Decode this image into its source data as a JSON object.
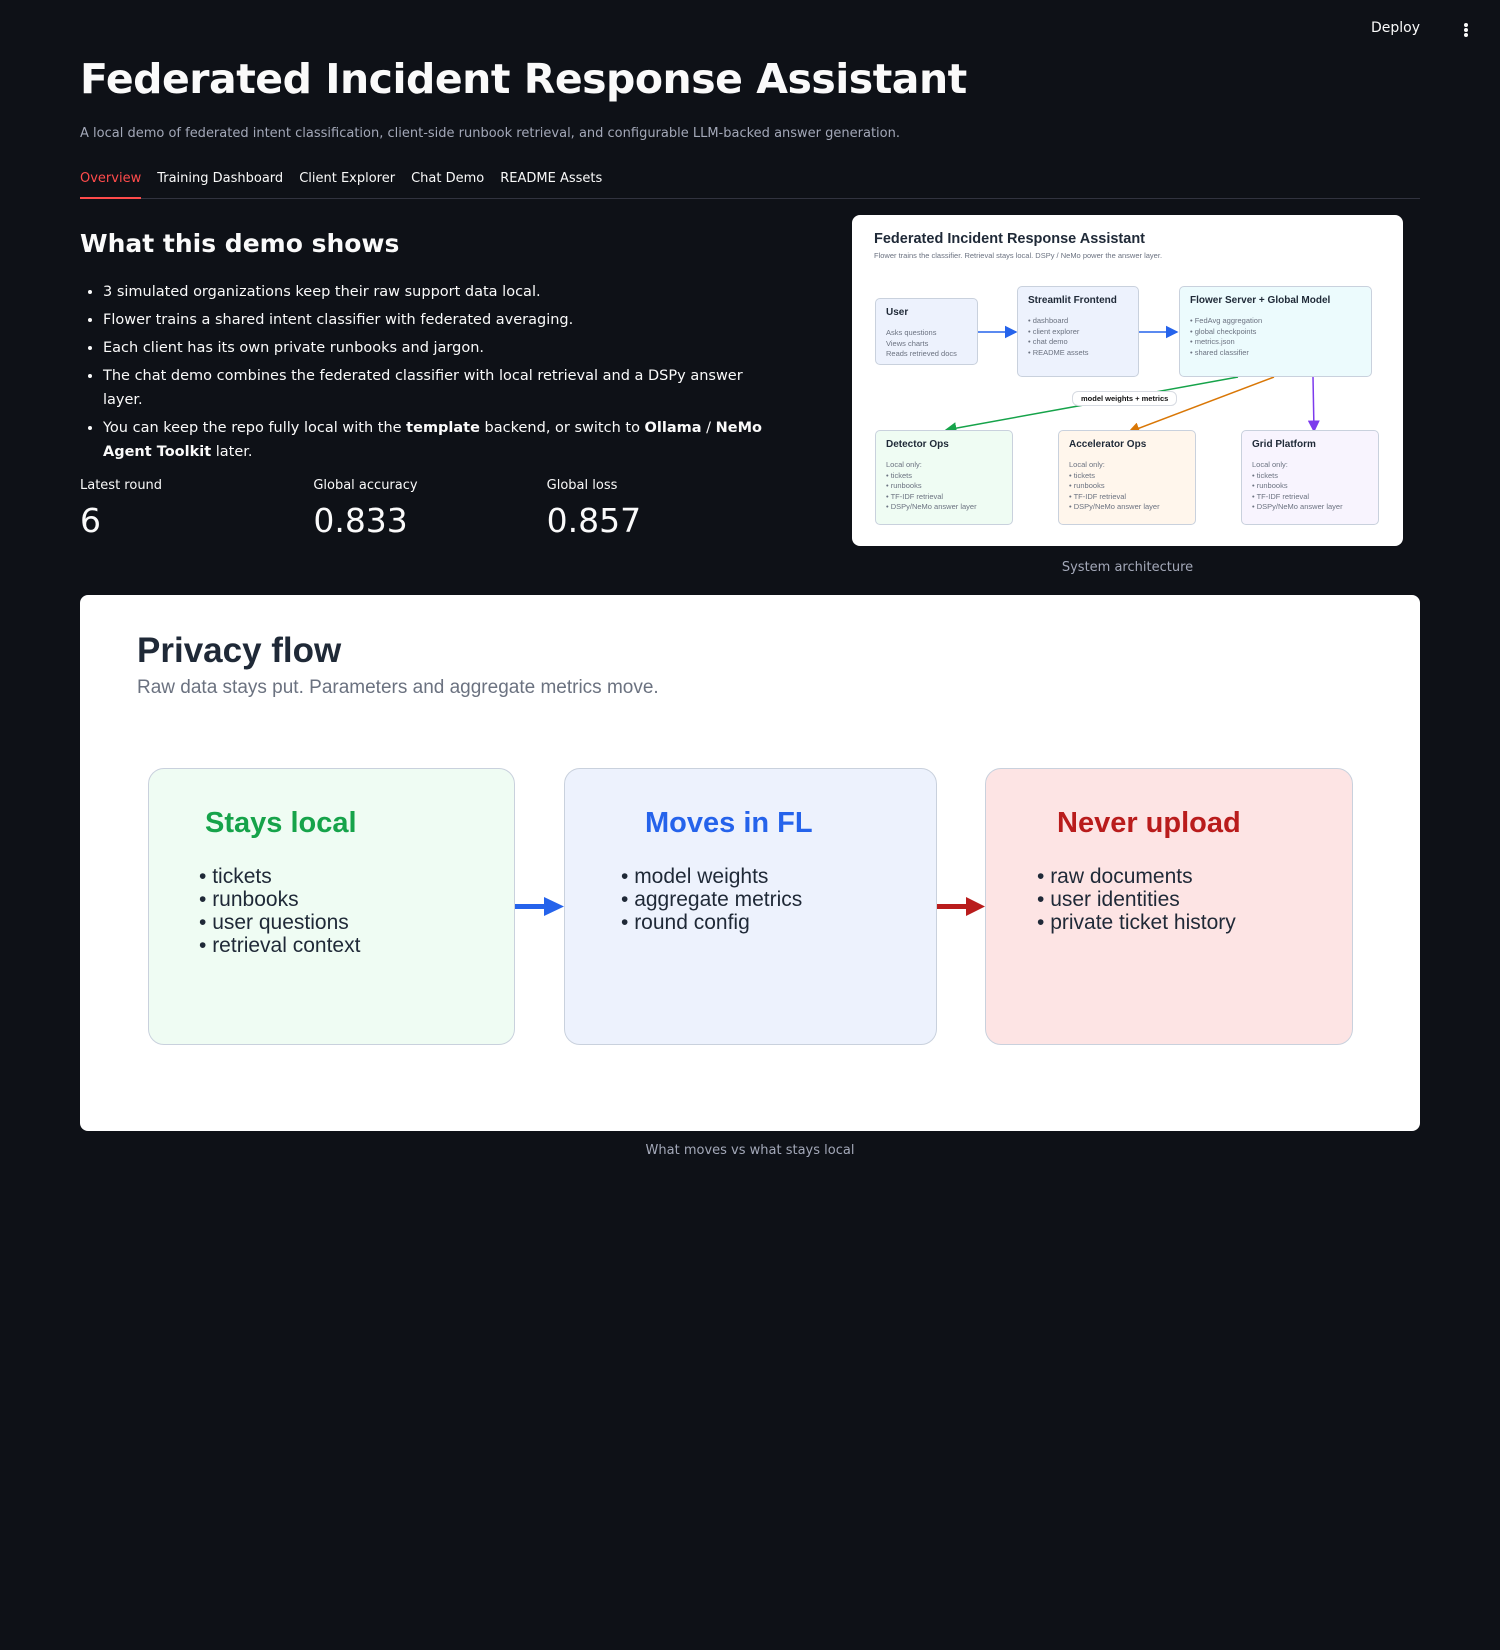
{
  "header": {
    "deploy_label": "Deploy",
    "menu_icon": "more-vertical-icon"
  },
  "page": {
    "title": "Federated Incident Response Assistant",
    "subtitle": "A local demo of federated intent classification, client-side runbook retrieval, and configurable LLM-backed answer generation."
  },
  "tabs": [
    {
      "label": "Overview",
      "active": true
    },
    {
      "label": "Training Dashboard",
      "active": false
    },
    {
      "label": "Client Explorer",
      "active": false
    },
    {
      "label": "Chat Demo",
      "active": false
    },
    {
      "label": "README Assets",
      "active": false
    }
  ],
  "overview": {
    "heading": "What this demo shows",
    "bullets": [
      "3 simulated organizations keep their raw support data local.",
      "Flower trains a shared intent classifier with federated averaging.",
      "Each client has its own private runbooks and jargon.",
      "The chat demo combines the federated classifier with local retrieval and a DSPy answer layer."
    ],
    "bullet5": {
      "part1": "You can keep the repo fully local with the ",
      "bold1": "template",
      "part2": " backend, or switch to ",
      "bold2": "Ollama",
      "part3": " / ",
      "bold3": "NeMo Agent Toolkit",
      "part4": " later."
    },
    "metrics": [
      {
        "label": "Latest round",
        "value": "6"
      },
      {
        "label": "Global accuracy",
        "value": "0.833"
      },
      {
        "label": "Global loss",
        "value": "0.857"
      }
    ]
  },
  "architecture": {
    "title": "Federated Incident Response Assistant",
    "subtitle": "Flower trains the classifier. Retrieval stays local. DSPy / NeMo power the answer layer.",
    "caption": "System architecture",
    "edge_label": "model weights + metrics",
    "boxes": {
      "user": {
        "title": "User",
        "lines": "Asks questions\nViews charts\nReads retrieved docs"
      },
      "frontend": {
        "title": "Streamlit Frontend",
        "lines": "• dashboard\n• client explorer\n• chat demo\n• README assets"
      },
      "server": {
        "title": "Flower Server + Global Model",
        "lines": "• FedAvg aggregation\n• global checkpoints\n• metrics.json\n• shared classifier"
      },
      "detector": {
        "title": "Detector Ops",
        "lines": "Local only:\n• tickets\n• runbooks\n• TF-IDF retrieval\n• DSPy/NeMo answer layer"
      },
      "accelerator": {
        "title": "Accelerator Ops",
        "lines": "Local only:\n• tickets\n• runbooks\n• TF-IDF retrieval\n• DSPy/NeMo answer layer"
      },
      "grid": {
        "title": "Grid Platform",
        "lines": "Local only:\n• tickets\n• runbooks\n• TF-IDF retrieval\n• DSPy/NeMo answer layer"
      }
    },
    "colors": {
      "blue": "#2563eb",
      "green": "#16a34a",
      "orange": "#d97706",
      "purple": "#7c3aed"
    }
  },
  "privacy": {
    "title": "Privacy flow",
    "subtitle": "Raw data stays put. Parameters and aggregate metrics move.",
    "caption": "What moves vs what stays local",
    "boxes": [
      {
        "title": "Stays local",
        "items": [
          "tickets",
          "runbooks",
          "user questions",
          "retrieval context"
        ],
        "title_color": "#16a34a",
        "bg": "#effcf3"
      },
      {
        "title": "Moves in FL",
        "items": [
          "model weights",
          "aggregate metrics",
          "round config"
        ],
        "title_color": "#2563eb",
        "bg": "#edf2fd"
      },
      {
        "title": "Never upload",
        "items": [
          "raw documents",
          "user identities",
          "private ticket history"
        ],
        "title_color": "#b91c1c",
        "bg": "#fde4e4"
      }
    ]
  }
}
